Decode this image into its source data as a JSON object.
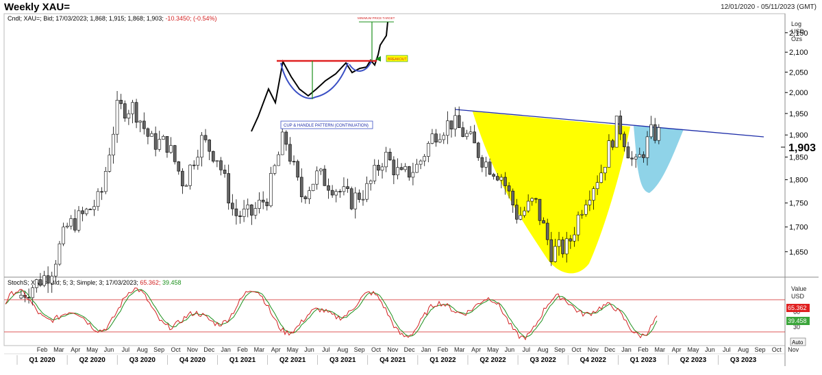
{
  "header": {
    "title": "Weekly XAU=",
    "date_range": "12/01/2020 - 05/11/2023 (GMT)"
  },
  "price_legend": {
    "prefix": "Cndl; XAU=; Bid; 17/03/2023; 1,868; 1,915; 1,868; 1,903;",
    "change": "-10.3450; (-0.54%)"
  },
  "stoch_legend": {
    "prefix": "StochS; XAU=; Bid;  5; 3; Simple; 3; 17/03/2023;",
    "k_value": "65.362;",
    "d_value": "39.458"
  },
  "price_axis": {
    "units": [
      "Log",
      "USD",
      "Ozs"
    ],
    "ticks": [
      "2,150",
      "2,100",
      "2,050",
      "2,000",
      "1,950",
      "1,900",
      "1,850",
      "1,800",
      "1,750",
      "1,700",
      "1,650"
    ],
    "last_price": "1,903"
  },
  "stoch_axis": {
    "units": [
      "Value",
      "USD"
    ],
    "ticks": [
      "60",
      "30"
    ],
    "k_badge": "65.362",
    "d_badge": "39.458",
    "auto_button": "Auto"
  },
  "annotations": {
    "cup_handle": "CUP & HANDLE PATTERN (CONTINUATION)",
    "min_target": "MINIMUM PRICE TARGET",
    "breakout": "BREAKOUT"
  },
  "chart_data": [
    {
      "type": "candlestick",
      "y_scale": "log",
      "ylim": [
        1600,
        2200
      ],
      "x_range": [
        "2020-01",
        "2023-11"
      ],
      "last_bar": {
        "date": "17/03/2023",
        "open": 1868,
        "high": 1915,
        "low": 1868,
        "close": 1903,
        "change": -10.345,
        "change_pct": -0.54
      },
      "close_path": [
        [
          "2020-01",
          1560
        ],
        [
          "2020-02",
          1585
        ],
        [
          "2020-03",
          1610
        ],
        [
          "2020-04",
          1700
        ],
        [
          "2020-05",
          1725
        ],
        [
          "2020-06",
          1760
        ],
        [
          "2020-07",
          1960
        ],
        [
          "2020-08",
          1965
        ],
        [
          "2020-09",
          1885
        ],
        [
          "2020-10",
          1880
        ],
        [
          "2020-11",
          1790
        ],
        [
          "2020-12",
          1890
        ],
        [
          "2021-01",
          1850
        ],
        [
          "2021-02",
          1725
        ],
        [
          "2021-03",
          1725
        ],
        [
          "2021-04",
          1765
        ],
        [
          "2021-05",
          1900
        ],
        [
          "2021-06",
          1765
        ],
        [
          "2021-07",
          1810
        ],
        [
          "2021-08",
          1785
        ],
        [
          "2021-09",
          1755
        ],
        [
          "2021-10",
          1780
        ],
        [
          "2021-11",
          1855
        ],
        [
          "2021-12",
          1805
        ],
        [
          "2022-01",
          1830
        ],
        [
          "2022-02",
          1905
        ],
        [
          "2022-03",
          1930
        ],
        [
          "2022-04",
          1895
        ],
        [
          "2022-05",
          1840
        ],
        [
          "2022-06",
          1810
        ],
        [
          "2022-07",
          1720
        ],
        [
          "2022-08",
          1755
        ],
        [
          "2022-09",
          1650
        ],
        [
          "2022-10",
          1660
        ],
        [
          "2022-11",
          1760
        ],
        [
          "2022-12",
          1820
        ],
        [
          "2023-01",
          1930
        ],
        [
          "2023-02",
          1825
        ],
        [
          "2023-03",
          1903
        ]
      ],
      "neckline": [
        [
          "2022-04",
          2000
        ],
        [
          "2023-09",
          1930
        ]
      ]
    },
    {
      "type": "line",
      "name": "StochS; 5; 3; Simple; 3",
      "ylim": [
        0,
        100
      ],
      "reference_lines": [
        80,
        20
      ],
      "series": [
        {
          "name": "%K",
          "color": "#d21f1f",
          "last": 65.362
        },
        {
          "name": "%D",
          "color": "#1a8f1a",
          "last": 39.458
        }
      ]
    }
  ],
  "x_axis": {
    "months": [
      "Feb",
      "Mar",
      "Apr",
      "May",
      "Jun",
      "Jul",
      "Aug",
      "Sep",
      "Oct",
      "Nov",
      "Dec",
      "Jan",
      "Feb",
      "Mar",
      "Apr",
      "May",
      "Jun",
      "Jul",
      "Aug",
      "Sep",
      "Oct",
      "Nov",
      "Dec",
      "Jan",
      "Feb",
      "Mar",
      "Apr",
      "May",
      "Jun",
      "Jul",
      "Aug",
      "Sep",
      "Oct",
      "Nov",
      "Dec",
      "Jan",
      "Feb",
      "Mar",
      "Apr",
      "May",
      "Jun",
      "Jul",
      "Aug",
      "Sep",
      "Oct",
      "Nov"
    ],
    "quarters": [
      "Q1 2020",
      "Q2 2020",
      "Q3 2020",
      "Q4 2020",
      "Q1 2021",
      "Q2 2021",
      "Q3 2021",
      "Q4 2021",
      "Q1 2022",
      "Q2 2022",
      "Q3 2022",
      "Q4 2022",
      "Q1 2023",
      "Q2 2023",
      "Q3 2023"
    ]
  },
  "colors": {
    "candle_up": "#ffffff",
    "candle_down": "#666666",
    "cup_fill": "#ffff00",
    "handle_fill": "#8fd3e8",
    "neckline": "#1c2ca8",
    "resistance": "#e02020",
    "cup_curve": "#3a4fc4",
    "stoch_k": "#d21f1f",
    "stoch_d": "#1a8f1a"
  }
}
